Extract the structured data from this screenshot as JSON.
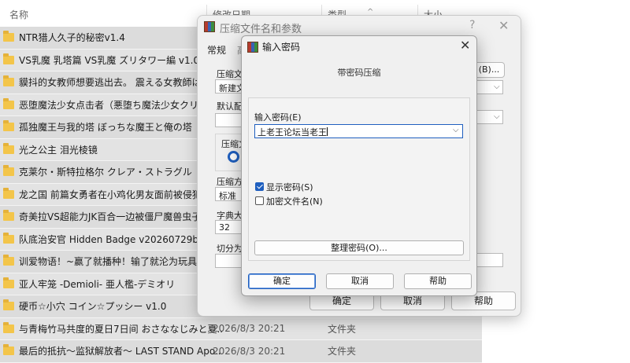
{
  "explorer": {
    "columns": {
      "name": "名称",
      "date": "修改日期",
      "type": "类型",
      "size": "大小"
    },
    "rows": [
      {
        "name": "NTR猎人久子的秘密v1.4",
        "date": "",
        "type": ""
      },
      {
        "name": "VS乳魔 乳塔篇 VS乳魔 ズリタワー編 v1.0.0",
        "date": "",
        "type": ""
      },
      {
        "name": "貘抖的女教师想要逃出去。 震える女教師は逃...",
        "date": "",
        "type": ""
      },
      {
        "name": "恶堕魔法少女点击者（悪堕ち魔法少女クリッカ...",
        "date": "",
        "type": ""
      },
      {
        "name": "孤独魔王与我的塔 ぼっちな魔王と俺の塔",
        "date": "",
        "type": ""
      },
      {
        "name": "光之公主 泪光棱镜",
        "date": "",
        "type": ""
      },
      {
        "name": "克莱尔・斯特拉格尔 クレア・ストラグル",
        "date": "",
        "type": ""
      },
      {
        "name": "龙之国 前篇女勇者在小鸡化男友面前被侵犯的...",
        "date": "",
        "type": ""
      },
      {
        "name": "奇美拉VS超能力JK百合一边被僵尸魔兽虫子侵...",
        "date": "",
        "type": ""
      },
      {
        "name": "队底治安官 Hidden Badge v20260729b",
        "date": "",
        "type": ""
      },
      {
        "name": "训爱物语！~赢了就播种！输了就沦为玩具！与...",
        "date": "",
        "type": ""
      },
      {
        "name": "亚人牢笼 -Demioli- 亜人檻-デミオリ",
        "date": "",
        "type": ""
      },
      {
        "name": "硬币☆小穴 コイン☆プッシー v1.0",
        "date": "",
        "type": ""
      },
      {
        "name": "与青梅竹马共度的夏日7日间 おさななじみと夏...",
        "date": "2026/8/3 20:21",
        "type": "文件夹"
      },
      {
        "name": "最后的抵抗～监狱解放者～ LAST STAND Apo...",
        "date": "2026/8/3 20:21",
        "type": "文件夹"
      }
    ]
  },
  "back_dialog": {
    "title": "压缩文件名和参数",
    "help": "?",
    "close": "✕",
    "tab_general": "常规",
    "tab_advanced": "高",
    "archive_name_label": "压缩文件",
    "archive_name_value": "新建文",
    "browse_button": "(B)...",
    "default_profile_label": "默认配置",
    "format_label": "压缩文",
    "method_label": "压缩方式",
    "method_value": "标准",
    "dict_label": "字典大小",
    "dict_value": "32",
    "split_label": "切分为分",
    "ok_button": "确定",
    "cancel_button": "取消",
    "help_button": "帮助"
  },
  "front_dialog": {
    "title": "输入密码",
    "close": "✕",
    "subtitle": "带密码压缩",
    "password_label": "输入密码(E)",
    "password_value": "上老王论坛当老王",
    "show_password_label": "显示密码(S)",
    "show_password_checked": true,
    "encrypt_names_label": "加密文件名(N)",
    "encrypt_names_checked": false,
    "organize_button": "整理密码(O)...",
    "ok_button": "确定",
    "cancel_button": "取消",
    "help_button": "帮助"
  },
  "colors": {
    "accent": "#1f5fbf",
    "folder": "#f3c54a",
    "row_bg": "#dcdcdc"
  },
  "icons": {
    "folder": "folder-icon",
    "app": "winrar-icon",
    "checkbox": "checkbox-icon",
    "dropdown": "chevron-down-icon"
  }
}
